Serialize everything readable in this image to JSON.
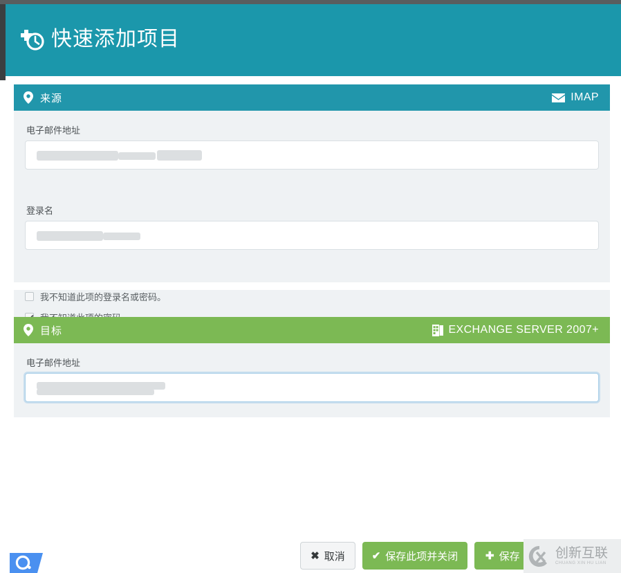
{
  "window": {
    "title": "快速添加项目",
    "title_icon": "plus-clock-icon",
    "header_color": "#1b97ab"
  },
  "sections": {
    "source": {
      "heading": "来源",
      "heading_icon": "location-pin-icon",
      "badge_label": "IMAP",
      "badge_icon": "envelope-icon",
      "accent_color": "#2196ab",
      "fields": [
        {
          "label": "电子邮件地址",
          "value": "",
          "placeholder": "",
          "focused": false
        },
        {
          "label": "登录名",
          "value": "",
          "placeholder": "",
          "focused": false
        }
      ],
      "checkboxes": [
        {
          "label": "我不知道此项的登录名或密码。",
          "checked": false
        },
        {
          "label": "我不知道此项的密码。",
          "checked": true
        }
      ]
    },
    "target": {
      "heading": "目标",
      "heading_icon": "location-pin-icon",
      "badge_label": "EXCHANGE SERVER 2007+",
      "badge_icon": "exchange-server-icon",
      "accent_color": "#7cb954",
      "fields": [
        {
          "label": "电子邮件地址",
          "value": "",
          "placeholder": "",
          "focused": true
        }
      ]
    }
  },
  "footer": {
    "cancel_label": "取消",
    "cancel_glyph": "✖",
    "save_close_label": "保存此项并关闭",
    "save_close_glyph": "✔",
    "save_new_label": "保存",
    "save_new_glyph": "✚"
  },
  "watermark": {
    "main_text": "创新互联",
    "sub_text": "CHUANG XIN HU LIAN",
    "logo_icon": "cx-circle-logo-icon"
  },
  "corner_badge": {
    "icon": "o-circle-logo-icon"
  }
}
